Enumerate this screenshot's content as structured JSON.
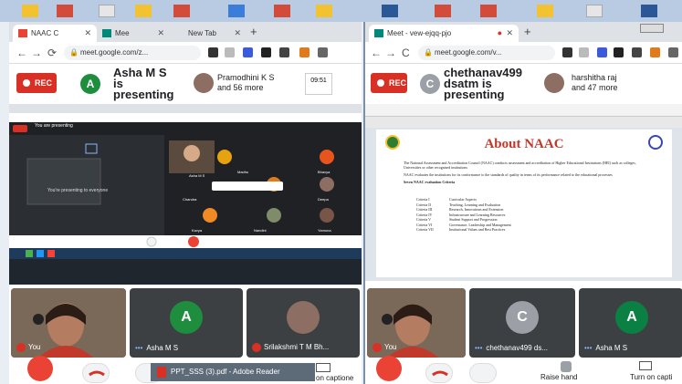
{
  "left": {
    "tabs": [
      {
        "label": "NAAC C",
        "active": true
      },
      {
        "label": "Mee",
        "active": false
      },
      {
        "label": "New Tab",
        "active": false
      }
    ],
    "url": "meet.google.com/z...",
    "rec_label": "REC",
    "presenter_initial": "A",
    "presenting_text": "Asha M S\nis\npresenting",
    "participants_text": "Pramodhini K S\nand 56 more",
    "clock_text": "09:51",
    "tiles": [
      {
        "name": "You",
        "type": "video"
      },
      {
        "name": "Asha M S",
        "initial": "A",
        "type": "avatar"
      },
      {
        "name": "Srilakshmi T M Bh...",
        "type": "video"
      }
    ],
    "controls": {
      "raise_hand": "",
      "captions": "on captione"
    },
    "taskbar_popup": "PPT_SSS (3).pdf - Adobe Reader",
    "inner_share_text": "You are presenting",
    "inner_present_msg": "You're presenting to everyone",
    "inner_tile_names": [
      "Asha M S",
      "Bhavya",
      "Chandra",
      "Deepa",
      "Kavya",
      "Nandini",
      "Madhu",
      "Yamuna"
    ]
  },
  "right": {
    "tab_label": "Meet - vew-ejqq-pjo",
    "url": "meet.google.com/v...",
    "rec_label": "REC",
    "presenter_initial": "C",
    "presenting_text": "chethanav499\ndsatm is\npresenting",
    "participants_text": "harshitha raj\nand 47 more",
    "slide": {
      "title": "About NAAC",
      "bullets": [
        "The National Assessment and Accreditation Council (NAAC) conducts assessment and accreditation of Higher Educational Institutions (HEI) such as colleges, Universities or other recognised institutions",
        "NAAC evaluates the institutions for its conformance to the standards of quality in terms of its performance related to the educational processes",
        "Seven NAAC evaluation Criteria"
      ],
      "criteria": [
        [
          "Criteria I",
          "Curricular Aspects"
        ],
        [
          "Criteria II",
          "Teaching, Learning and Evaluation"
        ],
        [
          "Criteria III",
          "Research, Innovations and Extension"
        ],
        [
          "Criteria IV",
          "Infrastructure and Learning Resources"
        ],
        [
          "Criteria V",
          "Student Support and Progression"
        ],
        [
          "Criteria VI",
          "Governance, Leadership and Management"
        ],
        [
          "Criteria VII",
          "Institutional Values and Best Practices"
        ]
      ]
    },
    "tiles": [
      {
        "name": "You",
        "type": "video"
      },
      {
        "name": "chethanav499 ds...",
        "initial": "C",
        "type": "avatar"
      },
      {
        "name": "Asha M S",
        "initial": "A",
        "type": "avatar"
      }
    ],
    "controls": {
      "raise_hand": "Raise hand",
      "captions": "Turn on capti"
    }
  },
  "colors": {
    "rec": "#d93025",
    "avatar_green": "#1e8e3e",
    "avatar_teal": "#0b8043",
    "avatar_grey": "#9aa0a6",
    "end_call": "#ea4335",
    "slide_title": "#c0392b"
  }
}
